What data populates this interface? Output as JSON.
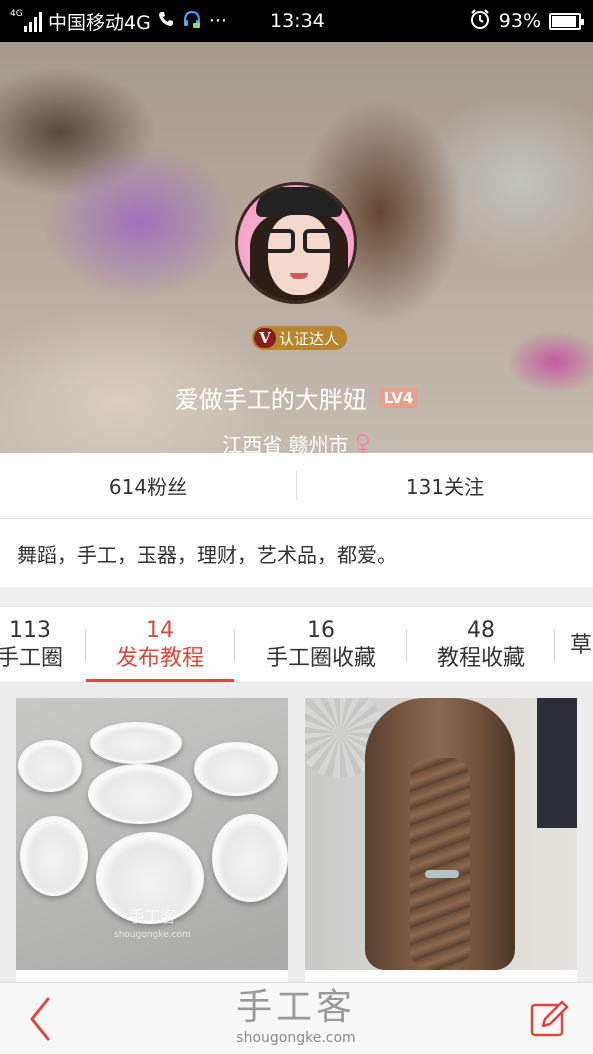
{
  "status_bar": {
    "network_tag": "4G",
    "carrier": "中国移动4G",
    "more": "···",
    "time": "13:34",
    "battery": "93%"
  },
  "profile": {
    "verified_badge_letter": "V",
    "verified_label": "认证达人",
    "username": "爱做手工的大胖妞",
    "level": "LV4",
    "location": "江西省 赣州市",
    "gender_symbol": "♀"
  },
  "stats": {
    "fans": "614粉丝",
    "following": "131关注"
  },
  "bio": "舞蹈，手工，玉器，理财，艺术品，都爱。",
  "tabs": [
    {
      "count": "113",
      "label": "手工圈"
    },
    {
      "count": "14",
      "label": "发布教程"
    },
    {
      "count": "16",
      "label": "手工圈收藏"
    },
    {
      "count": "48",
      "label": "教程收藏"
    },
    {
      "count": "",
      "label": "草"
    }
  ],
  "cards": {
    "watermark_cn": "手工客",
    "watermark_en": "shougongke.com"
  },
  "bottom_bar": {
    "logo_cn": "手工客",
    "logo_en": "shougongke.com"
  },
  "colors": {
    "accent": "#e0463c",
    "status_bar": "#000000",
    "verified_badge": "#b8852c",
    "level_badge": "#e8a08c",
    "gender": "#f08ab0"
  }
}
